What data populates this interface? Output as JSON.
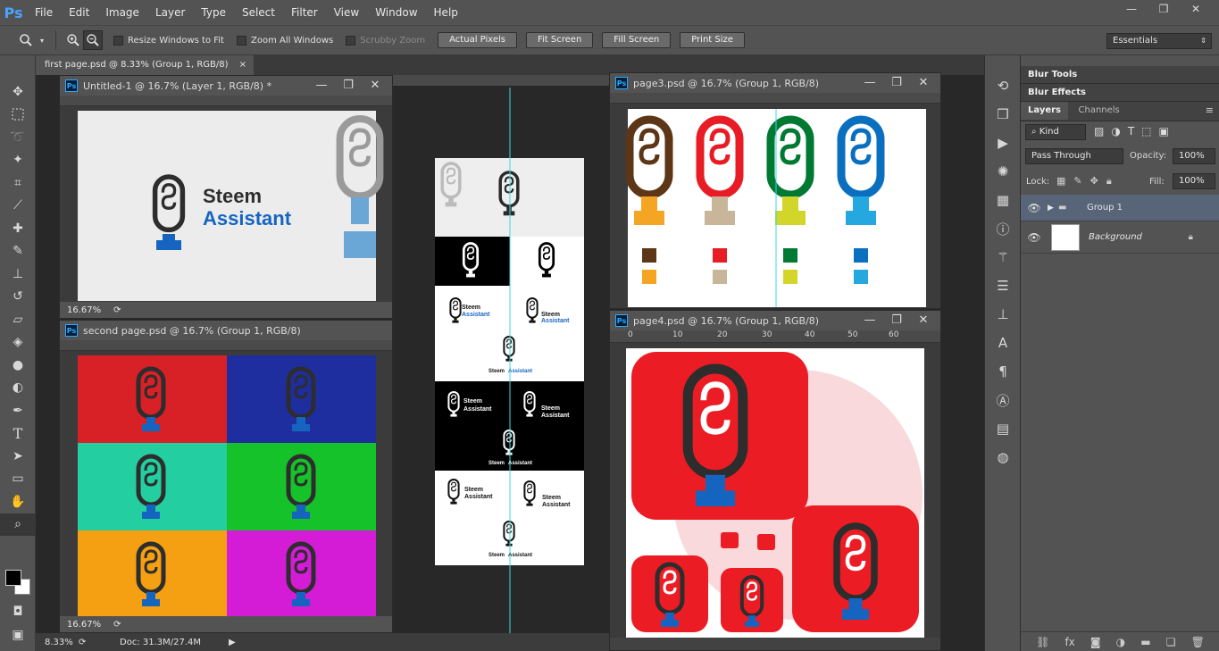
{
  "app": {
    "logo": "Ps"
  },
  "menu": [
    "File",
    "Edit",
    "Image",
    "Layer",
    "Type",
    "Select",
    "Filter",
    "View",
    "Window",
    "Help"
  ],
  "window_controls": {
    "minimize": "—",
    "restore": "❐",
    "close": "✕"
  },
  "options": {
    "resize_windows": "Resize Windows to Fit",
    "zoom_all": "Zoom All Windows",
    "scrubby": "Scrubby Zoom",
    "actual_pixels": "Actual Pixels",
    "fit_screen": "Fit Screen",
    "fill_screen": "Fill Screen",
    "print_size": "Print Size",
    "workspace": "Essentials"
  },
  "active_tab": "first page.psd @ 8.33% (Group 1, RGB/8)",
  "tab_close": "×",
  "status": {
    "zoom": "8.33%",
    "doc": "Doc: 31.3M/27.4M"
  },
  "docs": {
    "untitled": {
      "title": "Untitled-1 @ 16.7% (Layer 1, RGB/8) *",
      "zoom": "16.67%"
    },
    "second": {
      "title": "second page.psd @ 16.7% (Group 1, RGB/8)",
      "zoom": "16.67%"
    },
    "page3": {
      "title": "page3.psd @ 16.7% (Group 1, RGB/8)"
    },
    "page4": {
      "title": "page4.psd @ 16.7% (Group 1, RGB/8)",
      "zoom": "16.67%"
    }
  },
  "brand": {
    "line1": "Steem",
    "line2": "Assistant"
  },
  "colors": {
    "brand_blue": "#1565c0",
    "mic_dark": "#333333",
    "red": "#ec1c24",
    "second_tiles": [
      "#d82027",
      "#1f2e9e",
      "#23cfa0",
      "#16c22a",
      "#f5a013",
      "#d41cd6"
    ],
    "page3_mics": [
      {
        "main": "#5c3616",
        "stand": "#f5a524"
      },
      {
        "main": "#e81c24",
        "stand": "#c9b59a"
      },
      {
        "main": "#007a33",
        "stand": "#d2d62a"
      },
      {
        "main": "#0a6fbf",
        "stand": "#25a8e0"
      }
    ]
  },
  "ruler": {
    "page4": [
      "0",
      "10",
      "20",
      "30",
      "40",
      "50",
      "60"
    ]
  },
  "panels": {
    "blur_tools": "Blur Tools",
    "blur_effects": "Blur Effects",
    "tabs": [
      "Layers",
      "Channels"
    ],
    "kind": "Kind",
    "blend": "Pass Through",
    "opacity_label": "Opacity:",
    "opacity": "100%",
    "lock_label": "Lock:",
    "fill_label": "Fill:",
    "fill": "100%",
    "layers": [
      {
        "name": "Group 1",
        "type": "group"
      },
      {
        "name": "Background",
        "type": "image"
      }
    ]
  }
}
